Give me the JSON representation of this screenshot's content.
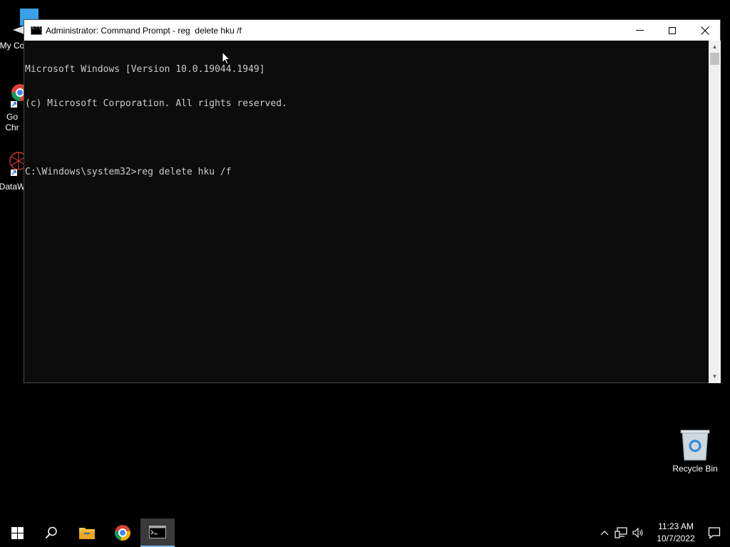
{
  "desktop": {
    "icons": [
      {
        "label": "My Co",
        "icon": "computer-icon"
      },
      {
        "label": "Go\nChr",
        "icon": "chrome-icon"
      },
      {
        "label": "DataW",
        "icon": "datawrapper-icon"
      },
      {
        "label": "Recycle Bin",
        "icon": "recycle-bin-icon"
      }
    ]
  },
  "window": {
    "title": "Administrator: Command Prompt - reg  delete hku /f",
    "lines": [
      "Microsoft Windows [Version 10.0.19044.1949]",
      "(c) Microsoft Corporation. All rights reserved.",
      "",
      "C:\\Windows\\system32>reg delete hku /f"
    ]
  },
  "taskbar": {
    "clock_time": "11:23 AM",
    "clock_date": "10/7/2022"
  }
}
